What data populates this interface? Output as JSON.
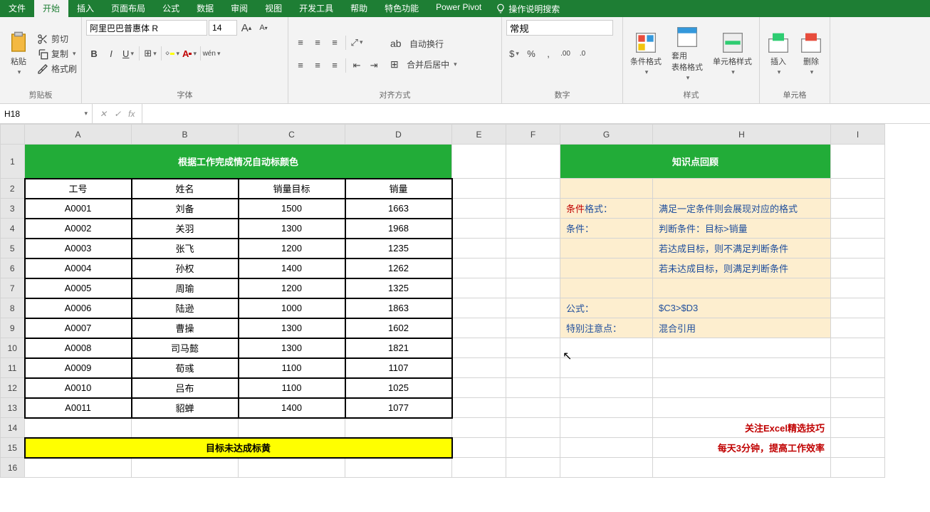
{
  "menu": {
    "tabs": [
      "文件",
      "开始",
      "插入",
      "页面布局",
      "公式",
      "数据",
      "审阅",
      "视图",
      "开发工具",
      "帮助",
      "特色功能",
      "Power Pivot"
    ],
    "active": 1,
    "tell": "操作说明搜索"
  },
  "ribbon": {
    "clipboard": {
      "label": "剪贴板",
      "paste": "粘贴",
      "cut": "剪切",
      "copy": "复制",
      "format": "格式刷"
    },
    "font": {
      "label": "字体",
      "name": "阿里巴巴普惠体 R",
      "size": "14"
    },
    "align": {
      "label": "对齐方式",
      "wrap": "自动换行",
      "merge": "合并后居中"
    },
    "number": {
      "label": "数字",
      "format": "常规"
    },
    "styles": {
      "label": "样式",
      "cond": "条件格式",
      "table": "套用\n表格格式",
      "cell": "单元格样式"
    },
    "cells": {
      "label": "单元格",
      "insert": "插入",
      "delete": "删除"
    }
  },
  "namebox": "H18",
  "sheet": {
    "cols": [
      "A",
      "B",
      "C",
      "D",
      "E",
      "F",
      "G",
      "H",
      "I"
    ],
    "title": "根据工作完成情况自动标颜色",
    "headers": [
      "工号",
      "姓名",
      "销量目标",
      "销量"
    ],
    "rows": [
      [
        "A0001",
        "刘备",
        "1500",
        "1663"
      ],
      [
        "A0002",
        "关羽",
        "1300",
        "1968"
      ],
      [
        "A0003",
        "张飞",
        "1200",
        "1235"
      ],
      [
        "A0004",
        "孙权",
        "1400",
        "1262"
      ],
      [
        "A0005",
        "周瑜",
        "1200",
        "1325"
      ],
      [
        "A0006",
        "陆逊",
        "1000",
        "1863"
      ],
      [
        "A0007",
        "曹操",
        "1300",
        "1602"
      ],
      [
        "A0008",
        "司马懿",
        "1300",
        "1821"
      ],
      [
        "A0009",
        "荀彧",
        "1100",
        "1107"
      ],
      [
        "A0010",
        "吕布",
        "1100",
        "1025"
      ],
      [
        "A0011",
        "貂蝉",
        "1400",
        "1077"
      ]
    ],
    "yellow": "目标未达成标黄",
    "knowledge": {
      "title": "知识点回顾",
      "items": [
        {
          "label": "条件",
          "label2": "格式：",
          "val": "满足一定条件则会展现对应的格式"
        },
        {
          "label": "条件：",
          "val": "判断条件：目标>销量"
        },
        {
          "label": "",
          "val": "若达成目标，则不满足判断条件"
        },
        {
          "label": "",
          "val": "若未达成目标，则满足判断条件"
        },
        {
          "label": "",
          "val": ""
        },
        {
          "label": "公式：",
          "val": "$C3>$D3"
        },
        {
          "label": "特别注意点：",
          "val": "混合引用"
        }
      ]
    },
    "footer": [
      "关注Excel精选技巧",
      "每天3分钟，提高工作效率"
    ]
  }
}
